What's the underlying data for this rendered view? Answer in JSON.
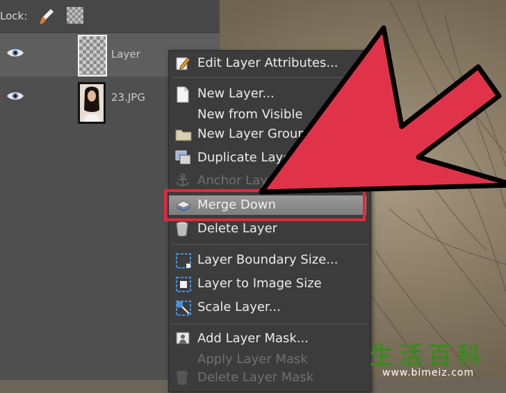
{
  "lock_bar": {
    "label": "Lock:"
  },
  "layers": [
    {
      "name": "Layer",
      "visible": true,
      "selected": true
    },
    {
      "name": "23.JPG",
      "visible": true,
      "selected": false
    }
  ],
  "context_menu": {
    "items": [
      {
        "label": "Edit Layer Attributes...",
        "icon": "edit-icon",
        "disabled": false
      },
      {
        "label": "New Layer...",
        "icon": "new-layer-icon",
        "disabled": false
      },
      {
        "label": "New from Visible",
        "icon": "",
        "disabled": false
      },
      {
        "label": "New Layer Group",
        "icon": "folder-icon",
        "disabled": false
      },
      {
        "label": "Duplicate Layer",
        "icon": "duplicate-icon",
        "disabled": false
      },
      {
        "label": "Anchor Layer",
        "icon": "anchor-icon",
        "disabled": true
      },
      {
        "label": "Merge Down",
        "icon": "merge-down-icon",
        "disabled": false,
        "highlighted": true
      },
      {
        "label": "Delete Layer",
        "icon": "trash-icon",
        "disabled": false
      },
      {
        "label": "Layer Boundary Size...",
        "icon": "boundary-icon",
        "disabled": false
      },
      {
        "label": "Layer to Image Size",
        "icon": "image-size-icon",
        "disabled": false
      },
      {
        "label": "Scale Layer...",
        "icon": "scale-icon",
        "disabled": false
      },
      {
        "label": "Add Layer Mask...",
        "icon": "mask-icon",
        "disabled": false
      },
      {
        "label": "Apply Layer Mask",
        "icon": "",
        "disabled": true
      },
      {
        "label": "Delete Layer Mask",
        "icon": "delete-mask-icon",
        "disabled": true
      }
    ]
  },
  "colors": {
    "highlight_frame": "#e02a3c",
    "arrow": "#e0334a",
    "watermark": "#3a8a1e"
  },
  "watermark": {
    "chinese": "生活百科",
    "url": "www.bimeiz.com"
  }
}
